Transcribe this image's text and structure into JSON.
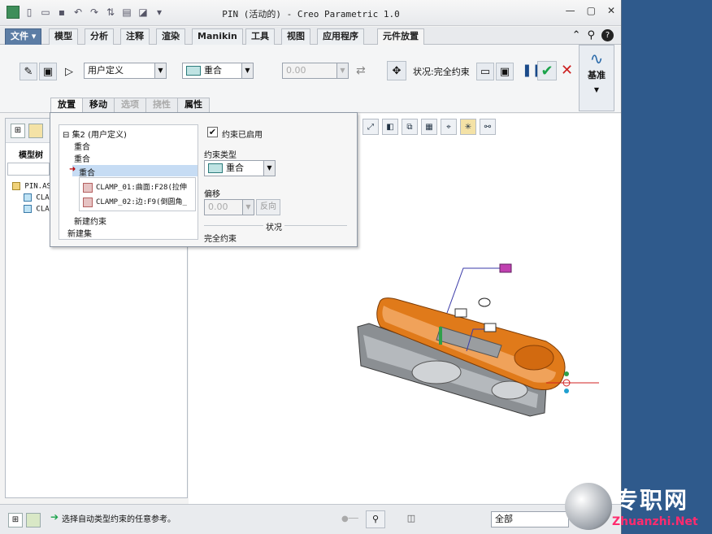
{
  "window": {
    "title": "PIN (活动的) - Creo Parametric 1.0"
  },
  "tabs": [
    "文件",
    "模型",
    "分析",
    "注释",
    "渲染",
    "Manikin",
    "工具",
    "视图",
    "应用程序",
    "元件放置"
  ],
  "ribbon": {
    "constraint_set_value": "用户定义",
    "constraint_type_value": "重合",
    "offset_value": "0.00",
    "status_label": "状况:完全约束",
    "datum_label": "基准"
  },
  "subtabs": [
    "放置",
    "移动",
    "选项",
    "挠性",
    "属性"
  ],
  "model_tree": {
    "label": "模型树",
    "items": [
      "PIN.ASM",
      "CLAMP",
      "CLAMP"
    ]
  },
  "placement": {
    "set_label": "集2 (用户定义)",
    "constraints": [
      "重合",
      "重合",
      "重合"
    ],
    "refs": [
      "CLAMP_01:曲面:F28(拉伸",
      "CLAMP_02:边:F9(倒圆角_"
    ],
    "new_constraint": "新建约束",
    "new_set": "新建集",
    "enabled_label": "约束已启用",
    "type_label": "约束类型",
    "type_value": "重合",
    "offset_label": "偏移",
    "offset_value": "0.00",
    "flip_label": "反向",
    "status_header": "状况",
    "status_value": "完全约束"
  },
  "statusbar": {
    "message": "选择自动类型约束的任意参考。",
    "filter": "全部"
  },
  "watermark": {
    "text": "专职网",
    "url": "Zhuanzhi.Net"
  },
  "colors": {
    "accent": "#5c7da5",
    "part": "#e07a1a",
    "check": "#1aa34a",
    "cancel": "#cc1f1f"
  }
}
